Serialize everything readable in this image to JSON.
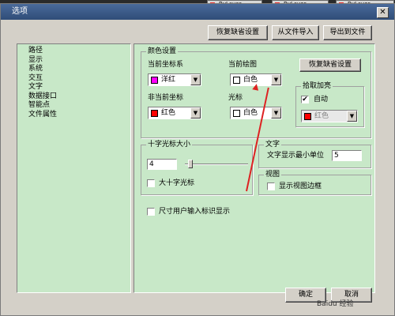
{
  "bg_toolbar": {
    "layers": [
      "ByLayer",
      "ByLayer",
      "ByLayer",
      "ByLayer"
    ]
  },
  "window": {
    "title": "选项",
    "close_glyph": "✕"
  },
  "top_buttons": {
    "restore_defaults": "恢复缺省设置",
    "import": "从文件导入",
    "export": "导出到文件"
  },
  "tree": {
    "items": [
      "路径",
      "显示",
      "系统",
      "交互",
      "文字",
      "数据接口",
      "智能点",
      "文件属性"
    ]
  },
  "color_settings": {
    "group_label": "颜色设置",
    "current_ucs_label": "当前坐标系",
    "current_ucs_value": "洋红",
    "current_ucs_color": "#ff00ff",
    "current_draw_label": "当前绘图",
    "current_draw_value": "白色",
    "current_draw_color": "#ffffff",
    "noncurrent_ucs_label": "非当前坐标",
    "noncurrent_ucs_value": "红色",
    "noncurrent_ucs_color": "#ff0000",
    "cursor_label": "光标",
    "cursor_value": "白色",
    "cursor_color": "#ffffff",
    "restore_button": "恢复缺省设置",
    "pick_highlight": {
      "label": "拾取加亮",
      "auto_label": "自动",
      "auto_checked": "✔",
      "value": "红色",
      "color": "#ff0000"
    }
  },
  "crosshair": {
    "group_label": "十字光标大小",
    "value": "4",
    "big_cross_label": "大十字光标",
    "level_percent": 5
  },
  "text_group": {
    "label": "文字",
    "min_unit_label": "文字显示最小单位",
    "min_unit_value": "5"
  },
  "view_group": {
    "label": "视图",
    "show_border_label": "显示视图边框"
  },
  "dimension_label": "尺寸用户输入标识显示",
  "bottom_buttons": {
    "ok": "确定",
    "cancel": "取消"
  },
  "watermark": "Baidu 经验",
  "accent_colors": {
    "title_bar": "#2f4d78",
    "panel_bg": "#c8e8c8",
    "annotation_arrow": "#dd2222"
  }
}
